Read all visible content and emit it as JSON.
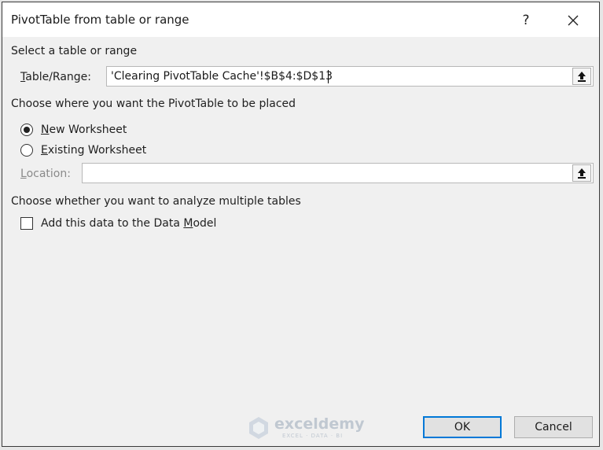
{
  "dialog": {
    "title": "PivotTable from table or range",
    "help_label": "?",
    "close_label": "✕"
  },
  "section1": {
    "label": "Select a table or range",
    "range_label_prefix": "T",
    "range_label_rest": "able/Range:",
    "range_value": "'Clearing PivotTable Cache'!$B$4:$D$13"
  },
  "section2": {
    "label": "Choose where you want the PivotTable to be placed",
    "new_ws_prefix": "N",
    "new_ws_rest": "ew Worksheet",
    "existing_ws_prefix": "E",
    "existing_ws_rest": "xisting Worksheet",
    "location_prefix": "L",
    "location_rest": "ocation:",
    "location_value": "",
    "selected": "new_worksheet"
  },
  "section3": {
    "label": "Choose whether you want to analyze multiple tables",
    "checkbox_label_pre": "Add this data to the Data ",
    "checkbox_label_ul": "M",
    "checkbox_label_post": "odel",
    "checked": false
  },
  "buttons": {
    "ok": "OK",
    "cancel": "Cancel"
  },
  "watermark": {
    "name": "exceldemy",
    "tagline": "EXCEL · DATA · BI"
  },
  "icons": {
    "collapse": "collapse-dialog-icon",
    "watermark_logo": "exceldemy-logo-icon"
  }
}
